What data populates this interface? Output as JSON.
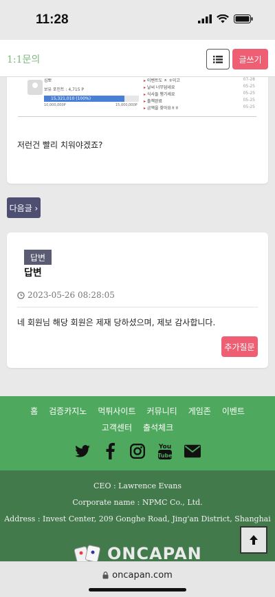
{
  "status": {
    "time": "11:28"
  },
  "header": {
    "title": "1:1문의",
    "list_icon": "list-icon",
    "write_label": "글쓰기"
  },
  "post": {
    "embedded": {
      "username": "심뽀",
      "points": "보유 포인트 : 4,715 P",
      "bar_label": "15,321,010 (100%)",
      "bar_fill": 0.85,
      "bar_left": "10,000,000P",
      "bar_right": "15,000,000P",
      "list": [
        {
          "title": "이벤트도 ㅈ ㅎ이고",
          "date": "07-28"
        },
        {
          "title": "날씨 너무덥네요",
          "date": "05-25"
        },
        {
          "title": "식사들 챙기세요",
          "date": "05-25"
        },
        {
          "title": "출첵완료",
          "date": "05-25"
        },
        {
          "title": "금액을 찾아요ㅎㅎ",
          "date": "05-25"
        }
      ]
    },
    "text": "저런건 빨리 치워야겠죠?"
  },
  "next_button": "다음글 ›",
  "answer": {
    "badge": "답변",
    "title": "답변",
    "date": "2023-05-26 08:28:05",
    "text": "네 회원님 해당 회원은 제재 당하셨으며, 제보 감사합니다.",
    "followup_label": "추가질문"
  },
  "footer": {
    "nav_row1": [
      "홈",
      "검증카지노",
      "먹튀사이트",
      "커뮤니티",
      "게임존",
      "이벤트"
    ],
    "nav_row2": [
      "고객센터",
      "출석체크"
    ],
    "social_icons": [
      "twitter-icon",
      "facebook-icon",
      "instagram-icon",
      "youtube-icon",
      "mail-icon"
    ],
    "ceo": "CEO : Lawrence Evans",
    "corporate": "Corporate name : NPMC Co., Ltd.",
    "address": "Address : Invest Center, 209 Gonghe Road, Jing'an District, Shanghai",
    "logo": "ONCAPAN"
  },
  "url": "oncapan.com",
  "colors": {
    "accent_pink": "#ef5f74",
    "footer_green": "#4ea85d",
    "footer_dark_green": "#427a4c",
    "navy": "#4d4e72"
  }
}
